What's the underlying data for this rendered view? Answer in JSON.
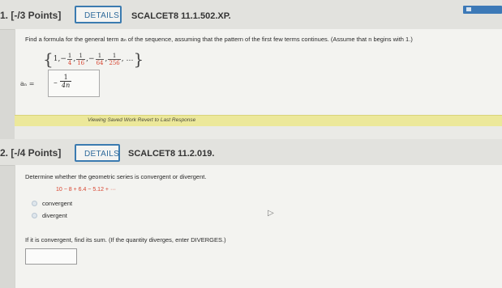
{
  "questions": [
    {
      "number": "1. [-/3 Points]",
      "details_label": "DETAILS",
      "code": "SCALCET8 11.1.502.XP.",
      "prompt": "Find a formula for the general term aₙ of the sequence, assuming that the pattern of the first few terms continues. (Assume that n begins with 1.)",
      "sequence": {
        "first": "1,",
        "fractions": [
          {
            "sign": "−",
            "num": "1",
            "den": "4"
          },
          {
            "sign": "",
            "num": "1",
            "den": "16"
          },
          {
            "sign": "−",
            "num": "1",
            "den": "64"
          },
          {
            "sign": "",
            "num": "1",
            "den": "256"
          }
        ],
        "ellipsis": ", …"
      },
      "answer_label": "aₙ =",
      "answer": {
        "sign": "−",
        "num": "1",
        "den": "4n"
      },
      "viewing_text": "Viewing Saved Work Revert to Last Response"
    },
    {
      "number": "2. [-/4 Points]",
      "details_label": "DETAILS",
      "code": "SCALCET8 11.2.019.",
      "prompt": "Determine whether the geometric series is convergent or divergent.",
      "series": "10 − 8 + 6.4 − 5.12 + ···",
      "options": [
        "convergent",
        "divergent"
      ],
      "followup": "If it is convergent, find its sum. (If the quantity diverges, enter DIVERGES.)",
      "sum_input": {
        "value": "",
        "placeholder": ""
      }
    }
  ],
  "colors": {
    "accent_blue": "#3b7bb0",
    "highlight_red": "#d8432e",
    "viewing_bar": "#ece89a"
  }
}
